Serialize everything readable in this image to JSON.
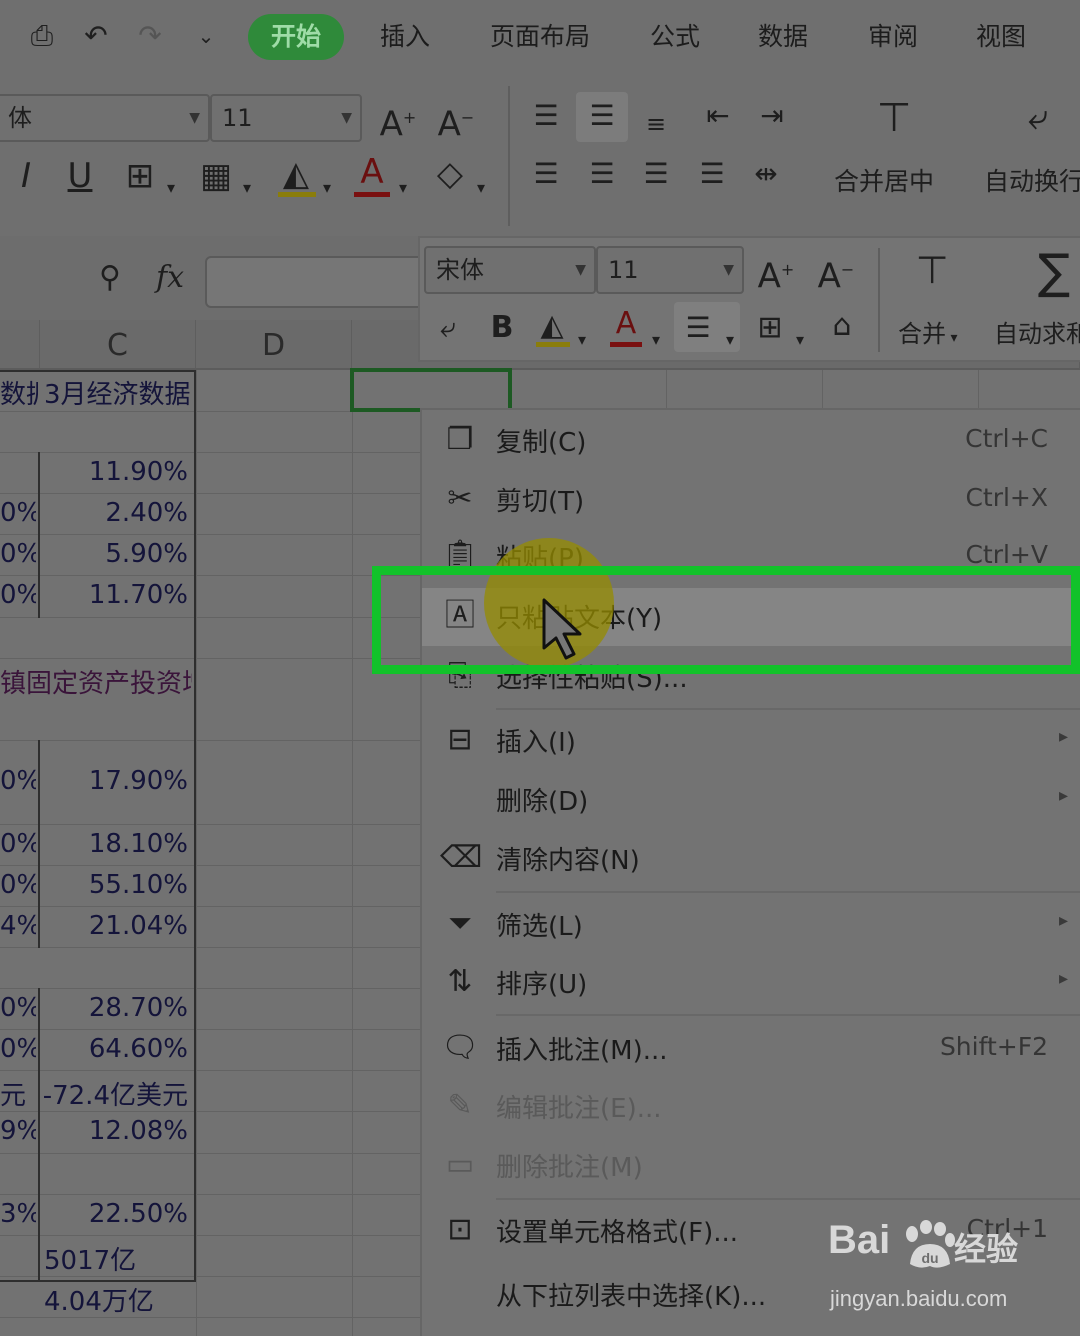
{
  "menu_tabs": [
    {
      "label": "开始",
      "active": true
    },
    {
      "label": "插入"
    },
    {
      "label": "页面布局"
    },
    {
      "label": "公式"
    },
    {
      "label": "数据"
    },
    {
      "label": "审阅"
    },
    {
      "label": "视图"
    }
  ],
  "ribbon": {
    "font_name_partial": "体",
    "font_size": "11",
    "merge_center_label": "合并居中",
    "auto_wrap_label": "自动换行"
  },
  "mini_toolbar": {
    "font_name": "宋体",
    "font_size": "11",
    "merge_label": "合并",
    "autosum_label": "自动求和"
  },
  "formula_bar": {
    "fx": "fx"
  },
  "columns": [
    "C",
    "D"
  ],
  "sheet": {
    "header_partial": "数据",
    "header_c": "3月经济数据",
    "rows": [
      {
        "b": "",
        "c": "11.90%"
      },
      {
        "b": "0%",
        "c": "2.40%"
      },
      {
        "b": "0%",
        "c": "5.90%"
      },
      {
        "b": "0%",
        "c": "11.70%"
      },
      {
        "b": "镇固定资产投资增",
        "c": ""
      },
      {
        "b": "0%",
        "c": "17.90%"
      },
      {
        "b": "0%",
        "c": "18.10%"
      },
      {
        "b": "0%",
        "c": "55.10%"
      },
      {
        "b": "4%",
        "c": "21.04%"
      },
      {
        "b": "0%",
        "c": "28.70%"
      },
      {
        "b": "0%",
        "c": "64.60%"
      },
      {
        "b": "元",
        "c": "-72.4亿美元"
      },
      {
        "b": "9%",
        "c": "12.08%"
      },
      {
        "b": "3%",
        "c": "22.50%"
      },
      {
        "b": "",
        "c": "5017亿"
      },
      {
        "b": "",
        "c": "4.04万亿"
      }
    ]
  },
  "context_menu": [
    {
      "icon": "copy-icon",
      "label": "复制(C)",
      "shortcut": "Ctrl+C"
    },
    {
      "icon": "scissors-icon",
      "label": "剪切(T)",
      "shortcut": "Ctrl+X"
    },
    {
      "icon": "paste-icon",
      "label": "粘贴(P)",
      "shortcut": "Ctrl+V"
    },
    {
      "icon": "paste-text-icon",
      "label": "只粘贴文本(Y)",
      "shortcut": "",
      "highlighted": true
    },
    {
      "icon": "paste-special-icon",
      "label": "选择性粘贴(S)...",
      "shortcut": ""
    },
    {
      "icon": "insert-icon",
      "label": "插入(I)",
      "shortcut": "",
      "submenu": true
    },
    {
      "icon": "",
      "label": "删除(D)",
      "shortcut": "",
      "submenu": true
    },
    {
      "icon": "eraser-icon",
      "label": "清除内容(N)",
      "shortcut": ""
    },
    {
      "icon": "filter-icon",
      "label": "筛选(L)",
      "shortcut": "",
      "submenu": true
    },
    {
      "icon": "sort-icon",
      "label": "排序(U)",
      "shortcut": "",
      "submenu": true
    },
    {
      "icon": "comment-add-icon",
      "label": "插入批注(M)...",
      "shortcut": "Shift+F2"
    },
    {
      "icon": "comment-edit-icon",
      "label": "编辑批注(E)...",
      "shortcut": "",
      "disabled": true
    },
    {
      "icon": "comment-delete-icon",
      "label": "删除批注(M)",
      "shortcut": "",
      "disabled": true
    },
    {
      "icon": "format-cells-icon",
      "label": "设置单元格格式(F)...",
      "shortcut": "Ctrl+1"
    },
    {
      "icon": "",
      "label": "从下拉列表中选择(K)...",
      "shortcut": ""
    }
  ],
  "watermark": {
    "brand": "Bai",
    "brand_cn": "经验",
    "url": "jingyan.baidu.com"
  },
  "colors": {
    "highlight_box": "#12c22a",
    "active_tab": "#2f8a3a"
  }
}
